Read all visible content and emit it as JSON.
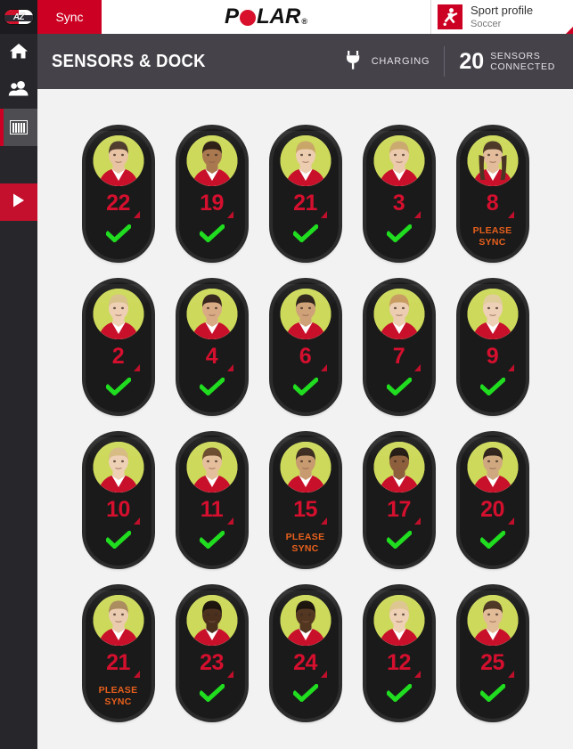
{
  "topbar": {
    "team_logo_text": "AZ",
    "team_logo_name": "az-alkmaar-logo",
    "sync_button_label": "Sync",
    "brand": {
      "pre": "P",
      "o_icon": "polar-red-circle",
      "post": "LAR",
      "registered": "®"
    },
    "profile": {
      "icon": "soccer-player-icon",
      "title": "Sport profile",
      "subtitle": "Soccer"
    }
  },
  "sidebar": {
    "items": [
      {
        "icon": "home-icon",
        "name": "sidebar-item-home",
        "active": false
      },
      {
        "icon": "team-icon",
        "name": "sidebar-item-team",
        "active": false
      },
      {
        "icon": "dock-icon",
        "name": "sidebar-item-sensors-dock",
        "active": true
      }
    ],
    "play_button": {
      "icon": "play-icon",
      "name": "sidebar-record-button"
    }
  },
  "page_header": {
    "title": "SENSORS & DOCK",
    "charging": {
      "icon": "power-plug-icon",
      "label": "CHARGING"
    },
    "sensors_connected": {
      "count": "20",
      "line1": "SENSORS",
      "line2": "CONNECTED"
    }
  },
  "colors": {
    "brand_red": "#cc0022",
    "jersey_red": "#d50f2e",
    "status_ok_green": "#20dd20",
    "status_warn_orange": "#e8601c",
    "header_dark": "#46424a",
    "sidebar_dark": "#26262b",
    "page_bg": "#f2f2f2",
    "sensor_body": "#1a1a1a",
    "avatar_bg": "#cdd95a"
  },
  "status_labels": {
    "ok_icon": "green-checkmark-icon",
    "sync_line1": "PLEASE",
    "sync_line2": "SYNC"
  },
  "sensors": [
    {
      "number": "22",
      "status": "ok",
      "hair": "#4b382a",
      "skin": "#e8c3a3",
      "long_hair": false
    },
    {
      "number": "19",
      "status": "ok",
      "hair": "#2a1c12",
      "skin": "#a9784f",
      "long_hair": false
    },
    {
      "number": "21",
      "status": "ok",
      "hair": "#c8a465",
      "skin": "#eccdb0",
      "long_hair": false
    },
    {
      "number": "3",
      "status": "ok",
      "hair": "#caa86d",
      "skin": "#ebc9ac",
      "long_hair": false
    },
    {
      "number": "8",
      "status": "sync",
      "hair": "#4a3524",
      "skin": "#e3bd9b",
      "long_hair": true
    },
    {
      "number": "2",
      "status": "ok",
      "hair": "#d8c08a",
      "skin": "#eecfb4",
      "long_hair": false
    },
    {
      "number": "4",
      "status": "ok",
      "hair": "#32221a",
      "skin": "#d9ab84",
      "long_hair": false
    },
    {
      "number": "6",
      "status": "ok",
      "hair": "#2b2119",
      "skin": "#cfa178",
      "long_hair": false
    },
    {
      "number": "7",
      "status": "ok",
      "hair": "#c79a5e",
      "skin": "#eccdb2",
      "long_hair": false
    },
    {
      "number": "9",
      "status": "ok",
      "hair": "#e0cc9a",
      "skin": "#eed0b6",
      "long_hair": false
    },
    {
      "number": "10",
      "status": "ok",
      "hair": "#d6bb82",
      "skin": "#eed0b5",
      "long_hair": false
    },
    {
      "number": "11",
      "status": "ok",
      "hair": "#6b4a2c",
      "skin": "#e5bf9c",
      "long_hair": false
    },
    {
      "number": "15",
      "status": "sync",
      "hair": "#3a2a1e",
      "skin": "#c79a70",
      "long_hair": false
    },
    {
      "number": "17",
      "status": "ok",
      "hair": "#221912",
      "skin": "#8d5f3c",
      "long_hair": false
    },
    {
      "number": "20",
      "status": "ok",
      "hair": "#2d2018",
      "skin": "#cfa87f",
      "long_hair": false
    },
    {
      "number": "21",
      "status": "sync",
      "hair": "#a98a5c",
      "skin": "#ebcbb0",
      "long_hair": false
    },
    {
      "number": "23",
      "status": "ok",
      "hair": "#161008",
      "skin": "#4a2f1d",
      "long_hair": false
    },
    {
      "number": "24",
      "status": "ok",
      "hair": "#171009",
      "skin": "#533620",
      "long_hair": false
    },
    {
      "number": "12",
      "status": "ok",
      "hair": "#ddc58f",
      "skin": "#eed0b4",
      "long_hair": false
    },
    {
      "number": "25",
      "status": "ok",
      "hair": "#4a3421",
      "skin": "#e2bb97",
      "long_hair": false
    }
  ]
}
